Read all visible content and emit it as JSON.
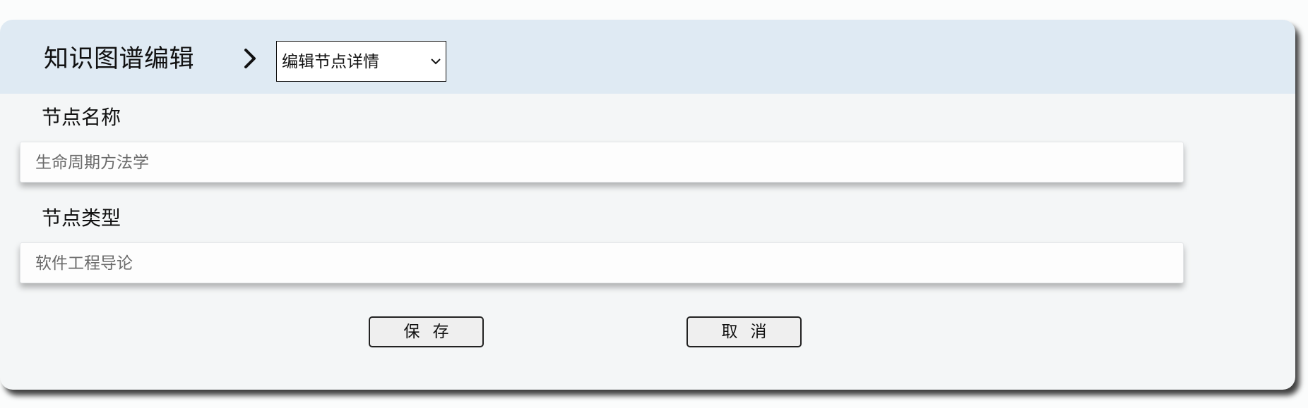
{
  "header": {
    "title": "知识图谱编辑",
    "separator_icon": "chevron-right-icon",
    "mode_select": {
      "selected": "编辑节点详情",
      "caret_icon": "chevron-down-icon"
    }
  },
  "form": {
    "fields": [
      {
        "label": "节点名称",
        "placeholder": "生命周期方法学",
        "value": ""
      },
      {
        "label": "节点类型",
        "placeholder": "软件工程导论",
        "value": ""
      }
    ]
  },
  "actions": {
    "save_label": "保存",
    "cancel_label": "取消"
  },
  "colors": {
    "header_bg": "#dfeaf3",
    "panel_bg": "#f4f6f7",
    "placeholder_text": "#6b6b6b"
  }
}
